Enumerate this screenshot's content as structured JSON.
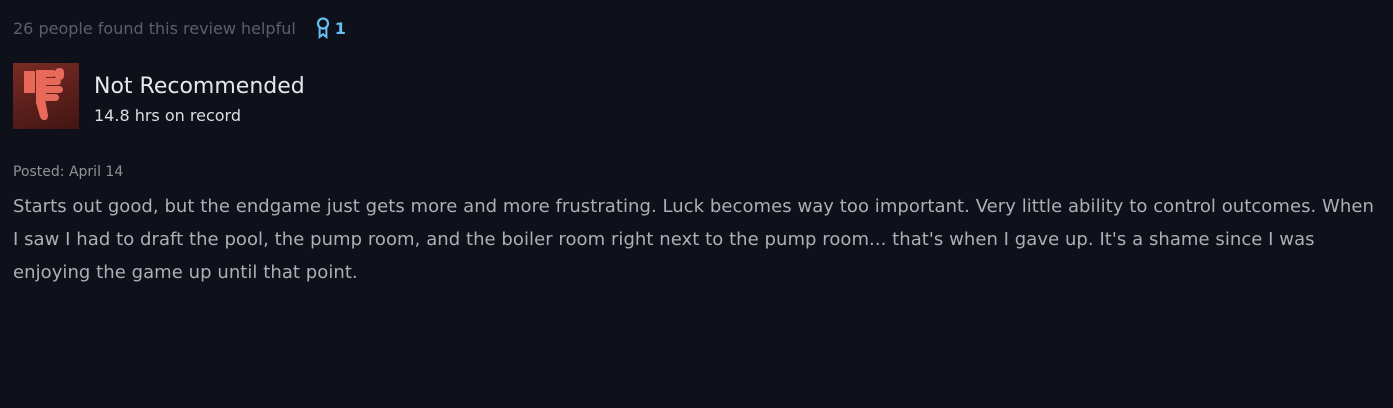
{
  "review": {
    "helpful_text": "26 people found this review helpful",
    "awards": {
      "icon": "award-ribbon-icon",
      "count": "1",
      "color": "#66c0f4"
    },
    "vote": {
      "icon": "thumbs-down-icon",
      "title": "Not Recommended",
      "hours": "14.8 hrs on record",
      "icon_bg_color": "#6b2420",
      "icon_color": "#e8685a"
    },
    "posted": "Posted: April 14",
    "body": "Starts out good, but the endgame just gets more and more frustrating. Luck becomes way too important. Very little ability to control outcomes. When I saw I had to draft the pool, the pump room, and the boiler room right next to the pump room... that's when I gave up. It's a shame since I was enjoying the game up until that point."
  }
}
